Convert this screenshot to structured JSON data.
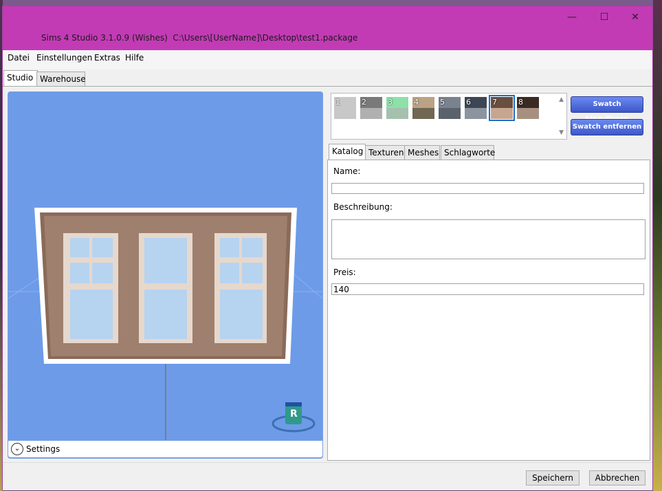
{
  "window": {
    "title": "Sims 4 Studio 3.1.0.9 (Wishes)  C:\\Users\\[UserName]\\Desktop\\test1.package",
    "minimize_glyph": "—",
    "maximize_glyph": "☐",
    "close_glyph": "✕"
  },
  "menu": [
    "Datei",
    "Einstellungen",
    "Extras",
    "Hilfe"
  ],
  "main_tabs": [
    {
      "label": "Studio",
      "active": true
    },
    {
      "label": "Warehouse",
      "active": false
    }
  ],
  "viewport": {
    "settings_label": "Settings",
    "gizmo_label": "R"
  },
  "swatches": [
    {
      "number": "1",
      "top": "#c8c8c8",
      "bottom": "#c8c8c8"
    },
    {
      "number": "2",
      "top": "#7a7a7a",
      "bottom": "#b0b0b0"
    },
    {
      "number": "3",
      "top": "#8ce0a8",
      "bottom": "#a6c0ae"
    },
    {
      "number": "4",
      "top": "#bca284",
      "bottom": "#706752"
    },
    {
      "number": "5",
      "top": "#7a8290",
      "bottom": "#5a626c"
    },
    {
      "number": "6",
      "top": "#3c4654",
      "bottom": "#8c94a0"
    },
    {
      "number": "7",
      "top": "#6a4e40",
      "bottom": "#c6a690",
      "selected": true
    },
    {
      "number": "8",
      "top": "#3a2a22",
      "bottom": "#a89080"
    }
  ],
  "swatch_buttons": {
    "add": "Swatch hinzufügen",
    "remove": "Swatch entfernen"
  },
  "catalog_tabs": [
    {
      "label": "Katalog",
      "active": true
    },
    {
      "label": "Texturen",
      "active": false
    },
    {
      "label": "Meshes",
      "active": false
    },
    {
      "label": "Schlagworte",
      "active": false
    }
  ],
  "catalog": {
    "name_label": "Name:",
    "name_value": "",
    "description_label": "Beschreibung:",
    "description_value": "",
    "price_label": "Preis:",
    "price_value": "140"
  },
  "footer": {
    "save": "Speichern",
    "cancel": "Abbrechen"
  },
  "colors": {
    "titlebar": "#c23bb5",
    "viewport": "#6d9be8",
    "accent": "#3c57c8"
  }
}
